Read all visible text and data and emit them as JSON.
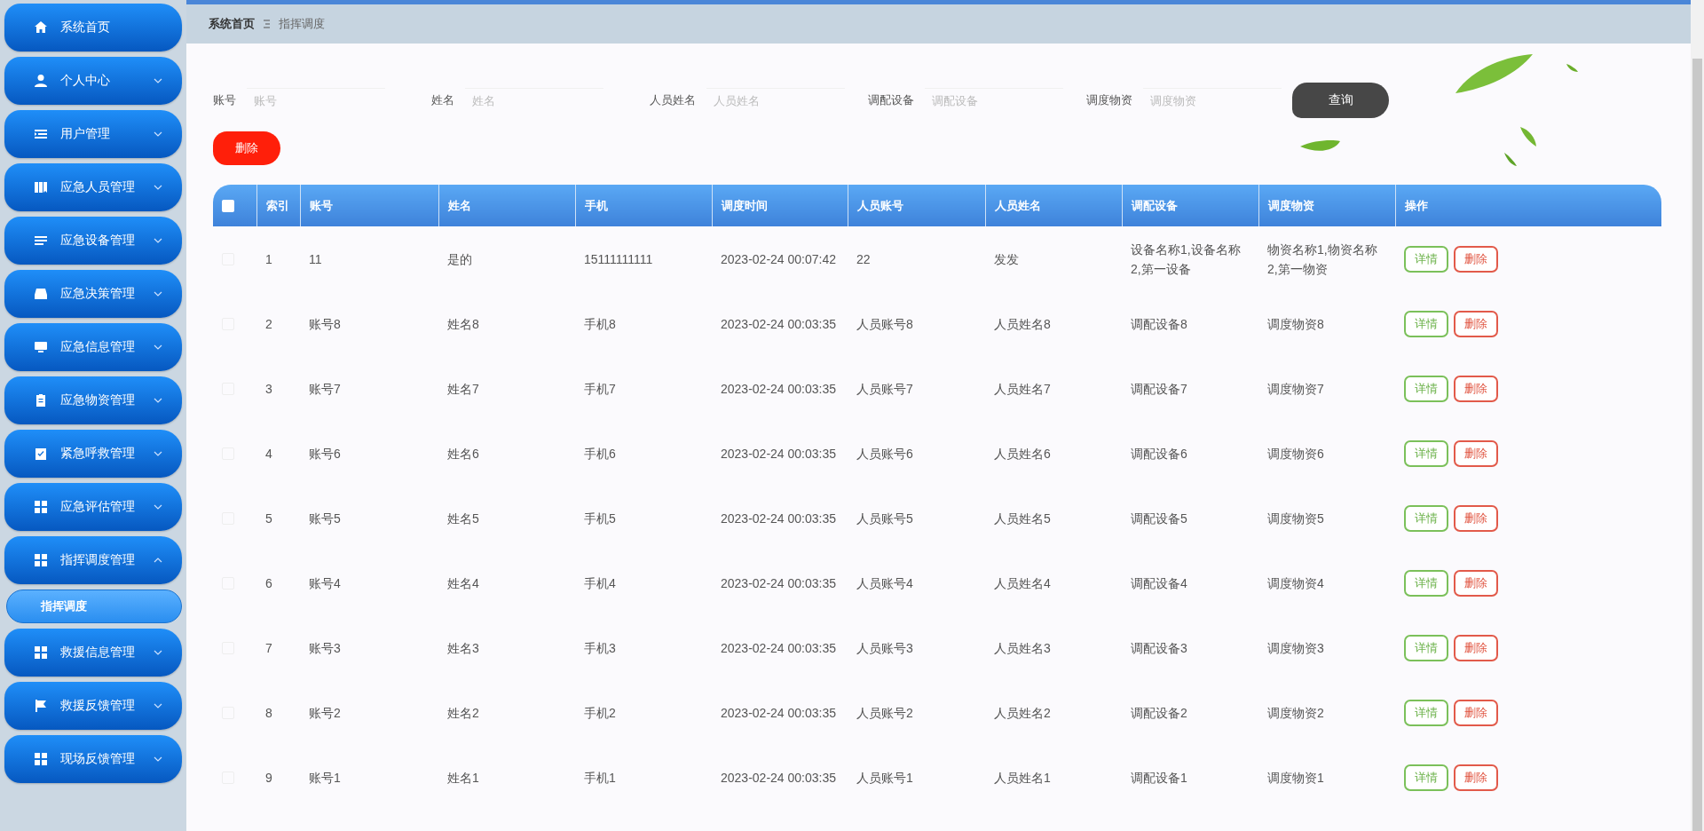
{
  "sidebar": {
    "items": [
      {
        "label": "系统首页",
        "kind": "link"
      },
      {
        "label": "个人中心",
        "kind": "menu",
        "expanded": false
      },
      {
        "label": "用户管理",
        "kind": "menu",
        "expanded": false
      },
      {
        "label": "应急人员管理",
        "kind": "menu",
        "expanded": false
      },
      {
        "label": "应急设备管理",
        "kind": "menu",
        "expanded": false
      },
      {
        "label": "应急决策管理",
        "kind": "menu",
        "expanded": false
      },
      {
        "label": "应急信息管理",
        "kind": "menu",
        "expanded": false
      },
      {
        "label": "应急物资管理",
        "kind": "menu",
        "expanded": false
      },
      {
        "label": "紧急呼救管理",
        "kind": "menu",
        "expanded": false
      },
      {
        "label": "应急评估管理",
        "kind": "menu",
        "expanded": false
      },
      {
        "label": "指挥调度管理",
        "kind": "menu",
        "expanded": true,
        "children": [
          {
            "label": "指挥调度",
            "selected": true
          }
        ]
      },
      {
        "label": "救援信息管理",
        "kind": "menu",
        "expanded": false
      },
      {
        "label": "救援反馈管理",
        "kind": "menu",
        "expanded": false
      },
      {
        "label": "现场反馈管理",
        "kind": "menu",
        "expanded": false
      }
    ]
  },
  "breadcrumb": [
    "系统首页",
    "指挥调度"
  ],
  "search": {
    "fields": [
      {
        "label": "账号",
        "placeholder": "账号"
      },
      {
        "label": "姓名",
        "placeholder": "姓名"
      },
      {
        "label": "人员姓名",
        "placeholder": "人员姓名"
      },
      {
        "label": "调配设备",
        "placeholder": "调配设备"
      },
      {
        "label": "调度物资",
        "placeholder": "调度物资"
      }
    ],
    "button": "查询"
  },
  "delete_button": "删除",
  "table": {
    "all_checked": false,
    "columns": [
      "索引",
      "账号",
      "姓名",
      "手机",
      "调度时间",
      "人员账号",
      "人员姓名",
      "调配设备",
      "调度物资",
      "操作"
    ],
    "rows": [
      {
        "checked": false,
        "cells": [
          "1",
          "11",
          "是的",
          "15111111111",
          "2023-02-24 00:07:42",
          "22",
          "发发",
          "设备名称1,设备名称2,第一设备",
          "物资名称1,物资名称2,第一物资"
        ],
        "actions": [
          "详情",
          "删除"
        ]
      },
      {
        "checked": false,
        "cells": [
          "2",
          "账号8",
          "姓名8",
          "手机8",
          "2023-02-24 00:03:35",
          "人员账号8",
          "人员姓名8",
          "调配设备8",
          "调度物资8"
        ],
        "actions": [
          "详情",
          "删除"
        ]
      },
      {
        "checked": false,
        "cells": [
          "3",
          "账号7",
          "姓名7",
          "手机7",
          "2023-02-24 00:03:35",
          "人员账号7",
          "人员姓名7",
          "调配设备7",
          "调度物资7"
        ],
        "actions": [
          "详情",
          "删除"
        ]
      },
      {
        "checked": false,
        "cells": [
          "4",
          "账号6",
          "姓名6",
          "手机6",
          "2023-02-24 00:03:35",
          "人员账号6",
          "人员姓名6",
          "调配设备6",
          "调度物资6"
        ],
        "actions": [
          "详情",
          "删除"
        ]
      },
      {
        "checked": false,
        "cells": [
          "5",
          "账号5",
          "姓名5",
          "手机5",
          "2023-02-24 00:03:35",
          "人员账号5",
          "人员姓名5",
          "调配设备5",
          "调度物资5"
        ],
        "actions": [
          "详情",
          "删除"
        ]
      },
      {
        "checked": false,
        "cells": [
          "6",
          "账号4",
          "姓名4",
          "手机4",
          "2023-02-24 00:03:35",
          "人员账号4",
          "人员姓名4",
          "调配设备4",
          "调度物资4"
        ],
        "actions": [
          "详情",
          "删除"
        ]
      },
      {
        "checked": false,
        "cells": [
          "7",
          "账号3",
          "姓名3",
          "手机3",
          "2023-02-24 00:03:35",
          "人员账号3",
          "人员姓名3",
          "调配设备3",
          "调度物资3"
        ],
        "actions": [
          "详情",
          "删除"
        ]
      },
      {
        "checked": false,
        "cells": [
          "8",
          "账号2",
          "姓名2",
          "手机2",
          "2023-02-24 00:03:35",
          "人员账号2",
          "人员姓名2",
          "调配设备2",
          "调度物资2"
        ],
        "actions": [
          "详情",
          "删除"
        ]
      },
      {
        "checked": false,
        "cells": [
          "9",
          "账号1",
          "姓名1",
          "手机1",
          "2023-02-24 00:03:35",
          "人员账号1",
          "人员姓名1",
          "调配设备1",
          "调度物资1"
        ],
        "actions": [
          "详情",
          "删除"
        ]
      }
    ]
  }
}
